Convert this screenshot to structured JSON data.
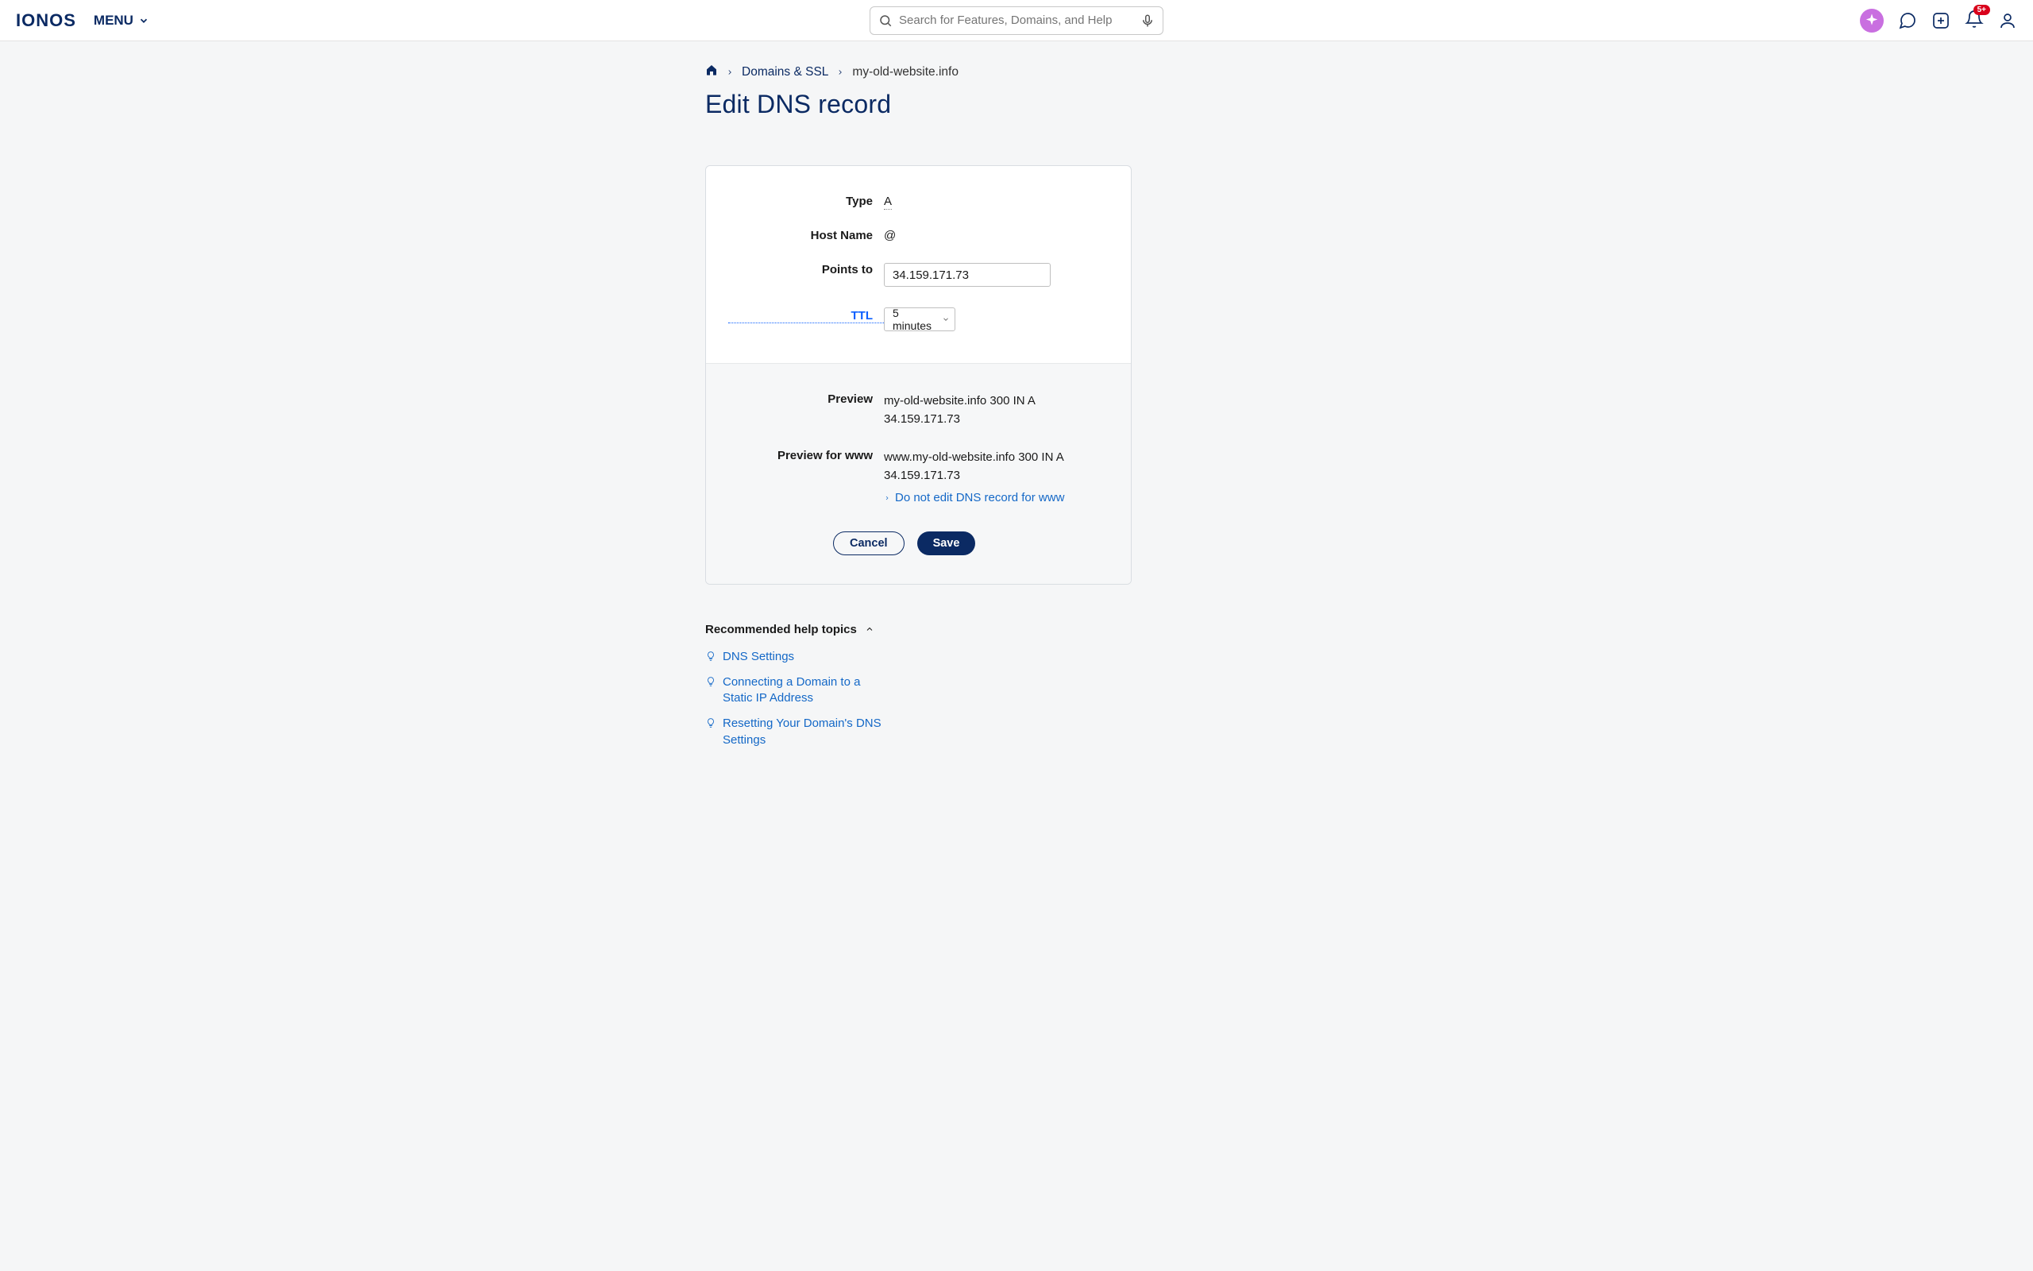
{
  "header": {
    "logo": "IONOS",
    "menu_label": "MENU",
    "search_placeholder": "Search for Features, Domains, and Help",
    "notification_badge": "5+"
  },
  "breadcrumb": {
    "level1": "Domains & SSL",
    "level2": "my-old-website.info"
  },
  "page_title": "Edit DNS record",
  "form": {
    "type_label": "Type",
    "type_value": "A",
    "hostname_label": "Host Name",
    "hostname_value": "@",
    "pointsto_label": "Points to",
    "pointsto_value": "34.159.171.73",
    "ttl_label": "TTL",
    "ttl_value": "5 minutes"
  },
  "preview": {
    "preview_label": "Preview",
    "preview_value": "my-old-website.info  300  IN  A  34.159.171.73",
    "previewwww_label": "Preview for www",
    "previewwww_value": "www.my-old-website.info  300  IN  A  34.159.171.73",
    "toggle_link": "Do not edit DNS record for www"
  },
  "buttons": {
    "cancel": "Cancel",
    "save": "Save"
  },
  "help": {
    "title": "Recommended help topics",
    "items": [
      "DNS Settings",
      "Connecting a Domain to a Static IP Address",
      "Resetting Your Domain's DNS Settings"
    ]
  }
}
